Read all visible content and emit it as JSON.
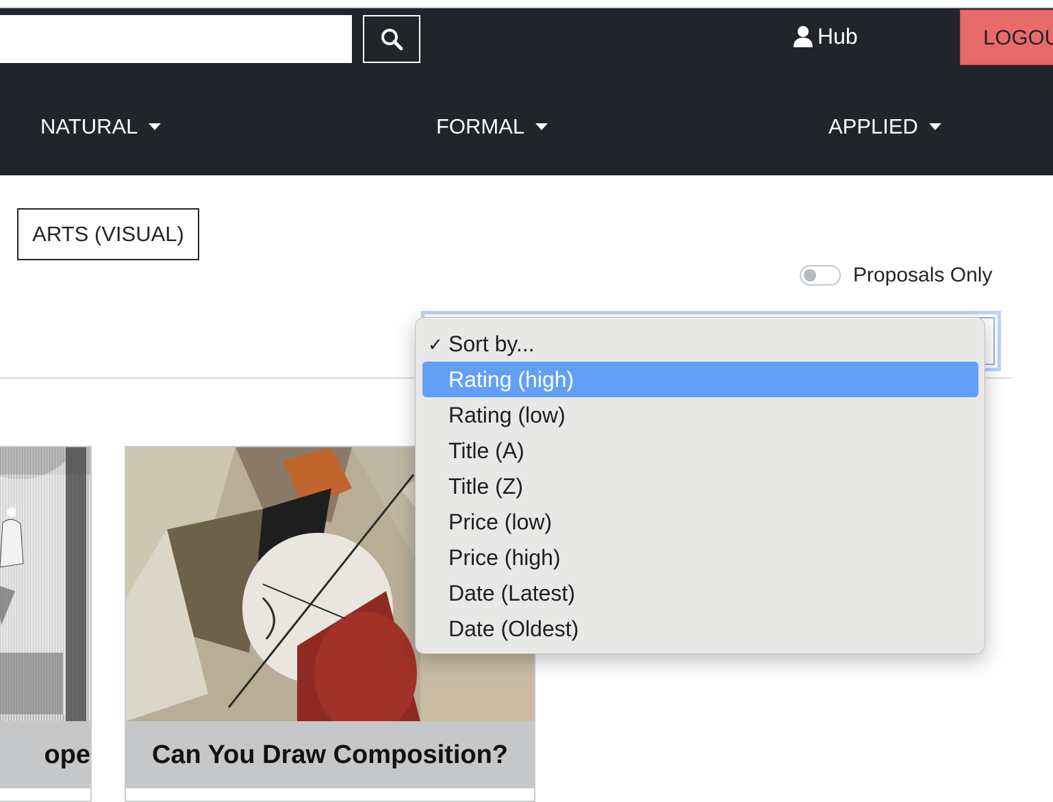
{
  "header": {
    "search": {
      "placeholder": "",
      "value": ""
    },
    "search_icon": "search-icon",
    "hub_label": "Hub",
    "hub_icon": "user-icon",
    "logout_label": "LOGOU"
  },
  "nav": {
    "items": [
      {
        "label": "NATURAL"
      },
      {
        "label": "FORMAL"
      },
      {
        "label": "APPLIED"
      }
    ]
  },
  "main": {
    "category_badge": "ARTS (VISUAL)",
    "proposals_toggle": {
      "label": "Proposals Only",
      "on": false
    },
    "sort_dropdown": {
      "selected": "Sort by...",
      "highlighted": "Rating (high)",
      "options": [
        {
          "label": "Sort by...",
          "checked": true
        },
        {
          "label": "Rating (high)"
        },
        {
          "label": "Rating (low)"
        },
        {
          "label": "Title (A)"
        },
        {
          "label": "Title (Z)"
        },
        {
          "label": "Price (low)"
        },
        {
          "label": "Price (high)"
        },
        {
          "label": "Date (Latest)"
        },
        {
          "label": "Date (Oldest)"
        }
      ]
    },
    "cards": [
      {
        "title": "ope"
      },
      {
        "title": "Can You Draw Composition?"
      }
    ]
  },
  "colors": {
    "navbar_bg": "#212529",
    "logout_bg": "#e96a6a",
    "highlight": "#62a0f7",
    "card_footer_bg": "#c6c7c8"
  }
}
